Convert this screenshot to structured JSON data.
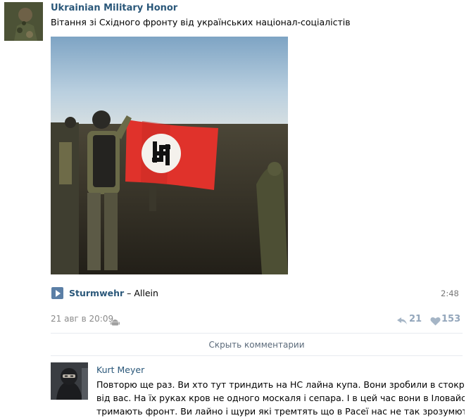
{
  "post": {
    "author": "Ukrainian Military Honor",
    "text": "Вітання зі Східного фронту від українських націонал-соціалістів"
  },
  "audio": {
    "artist": "Sturmwehr",
    "separator": "–",
    "title": "Allein",
    "duration": "2:48"
  },
  "meta": {
    "date": "21 авг в 20:09",
    "reposts": "21",
    "likes": "153"
  },
  "comments": {
    "toggle_label": "Скрыть комментарии",
    "items": [
      {
        "author": "Kurt Meyer",
        "lines": [
          "Повторю ще раз. Ви хто тут триндить на НС лайна купа. Вони зробили в стократ більше",
          "від вас. На їх руках кров не одного москаля і сепара. І в цей час вони в Іловайську",
          "тримають фронт. Ви лайно і щури які тремтять що в Расеї нас не так зрозумють чи у повії"
        ]
      }
    ]
  },
  "colors": {
    "link": "#2b587a",
    "counter": "#93a6bb",
    "muted": "#8a8a8a"
  }
}
